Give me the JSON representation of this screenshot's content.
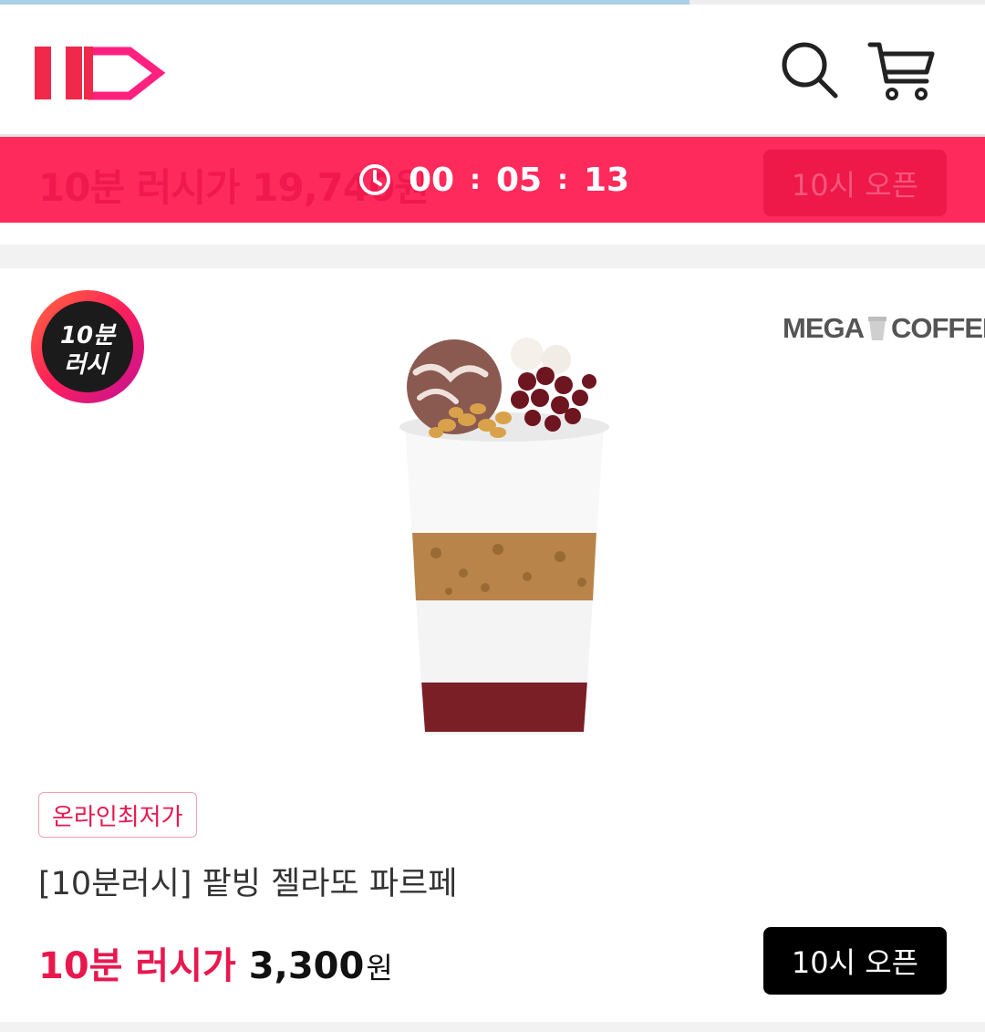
{
  "load_progress": 0.7,
  "header": {
    "logo_alt": "11번가",
    "search_icon": "search-icon",
    "cart_icon": "cart-icon"
  },
  "rush_bar": {
    "background_price": "10분 러시가 19,740원",
    "timer": {
      "hours": "00",
      "minutes": "05",
      "seconds": "13",
      "separator": ":"
    },
    "button_label": "10시 오픈"
  },
  "product": {
    "badge_line1": "10분",
    "badge_line2": "러시",
    "brand_left": "MEGA",
    "brand_right": "COFFEE",
    "tag": "온라인최저가",
    "title": "[10분러시] 팥빙 젤라또 파르페",
    "price_label": "10분 러시가",
    "price_value": "3,300",
    "price_unit": "원",
    "button_label": "10시 오픈"
  },
  "colors": {
    "brand_red": "#ff2a5c",
    "accent_pink": "#e8184f",
    "button_black": "#000000"
  }
}
